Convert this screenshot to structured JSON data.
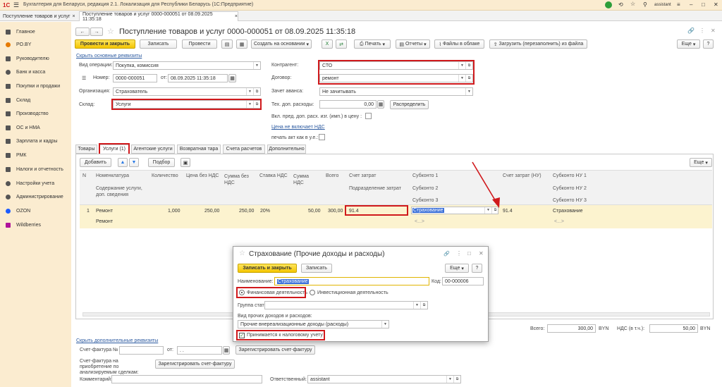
{
  "app": {
    "title": "Бухгалтерия для Беларуси, редакция 2.1. Локализация для Республики Беларусь  (1С:Предприятие)",
    "user": "assistant"
  },
  "tabs": [
    "Поступление товаров и услуг",
    "Поступление товаров и услуг 0000-000051 от 08.09.2025 11:35:18"
  ],
  "sidebar": {
    "items": [
      "Главное",
      "PO.BY",
      "Руководителю",
      "Банк и касса",
      "Покупки и продажи",
      "Склад",
      "Производство",
      "ОС и НМА",
      "Зарплата и кадры",
      "РМК",
      "Налоги и отчетность",
      "Настройки учета",
      "Администрирование",
      "OZON",
      "Wildberries"
    ]
  },
  "doc": {
    "title": "Поступление товаров и услуг 0000-000051 от 08.09.2025 11:35:18",
    "toolbar": {
      "post_close": "Провести и закрыть",
      "save": "Записать",
      "post": "Провести",
      "create_based": "Создать на основании",
      "print": "Печать",
      "reports": "Отчеты",
      "cloud_files": "Файлы в облаке",
      "load": "Загрузить (перезаполнить) из файла",
      "more": "Еще"
    },
    "hide_main_link": "Скрыть основные реквизиты",
    "op_type_label": "Вид операции:",
    "op_type": "Покупка, комиссия",
    "number_label": "Номер:",
    "number": "0000-000051",
    "date_label": "от:",
    "date": "08.09.2025 11:35:18",
    "org_label": "Организация:",
    "org": "Страхователь",
    "warehouse_label": "Склад:",
    "warehouse": "Услуги",
    "contractor_label": "Контрагент:",
    "contractor": "СТО",
    "contract_label": "Договор:",
    "contract": "ремонт",
    "advance_label": "Зачет аванса:",
    "advance": "Не зачитывать",
    "extra_exp_label": "Тех. доп. расходы:",
    "extra_exp": "0,00",
    "distribute": "Распределить",
    "incl_label": "Вкл. пред. доп. расх. изг. (имп.) в цену :",
    "vat_link": "Цена не включает НДС",
    "print_act_label": "печать акт как в у.е.:"
  },
  "tabsection": {
    "tabs": [
      "Товары",
      "Услуги (1)",
      "Агентские услуги",
      "Возвратная тара",
      "Счета расчетов",
      "Дополнительно"
    ],
    "add": "Добавить",
    "select": "Подбор",
    "more": "Еще",
    "headers": {
      "n": "N",
      "nomen": "Номенклатура",
      "content": "Содержание услуги, доп. сведения",
      "qty": "Количество",
      "price": "Цена без НДС",
      "sum": "Сумма без НДС",
      "rate": "Ставка НДС",
      "vat": "Сумма НДС",
      "total": "Всего",
      "acc": "Счет затрат",
      "dept": "Подразделение затрат",
      "sub1": "Субконто 1",
      "sub2": "Субконто 2",
      "sub3": "Субконто 3",
      "acc_nu": "Счет затрат (НУ)",
      "sub_nu1": "Субконто НУ 1",
      "sub_nu2": "Субконто НУ 2",
      "sub_nu3": "Субконто НУ 3"
    },
    "row": {
      "n": "1",
      "nomen": "Ремонт",
      "content": "Ремонт",
      "qty": "1,000",
      "price": "250,00",
      "sum": "250,00",
      "rate": "20%",
      "vat": "50,00",
      "total": "300,00",
      "acc": "91.4",
      "sub1": "Страхование",
      "acc_nu": "91.4",
      "sub_nu1": "Страхование",
      "empty": "<...>"
    }
  },
  "totals": {
    "total_label": "Всего:",
    "total": "300,00",
    "cur": "BYN",
    "vat_label": "НДС (в т.ч.):",
    "vat": "50,00",
    "cur2": "BYN"
  },
  "footer": {
    "hide_extra": "Скрыть дополнительные реквизиты",
    "invoice_label": "Счет-фактура №",
    "invoice_date_label": "от:",
    "invoice_date": ". .",
    "register_invoice": "Зарегистрировать счет-фактуру",
    "invoice_purchase_label": "Счет-фактура на приобретение по анализируемым сделкам:",
    "register_invoice2": "Зарегистрировать счет-фактуру",
    "comment_label": "Комментарий:",
    "responsible_label": "Ответственный:",
    "responsible": "assistant"
  },
  "dialog": {
    "title": "Страхование (Прочие доходы и расходы)",
    "save_close": "Записать и закрыть",
    "save": "Записать",
    "more": "Еще",
    "help": "?",
    "name_label": "Наименование:",
    "name": "Страхование",
    "code_label": "Код:",
    "code": "00-000006",
    "radio_fin": "Финансовая деятельность",
    "radio_inv": "Инвестиционная деятельность",
    "group_label": "Группа статей:",
    "type_label": "Вид прочих доходов и расходов:",
    "type": "Прочие внереализационные доходы (расходы)",
    "tax_check": "Принимается к налоговому учету"
  }
}
